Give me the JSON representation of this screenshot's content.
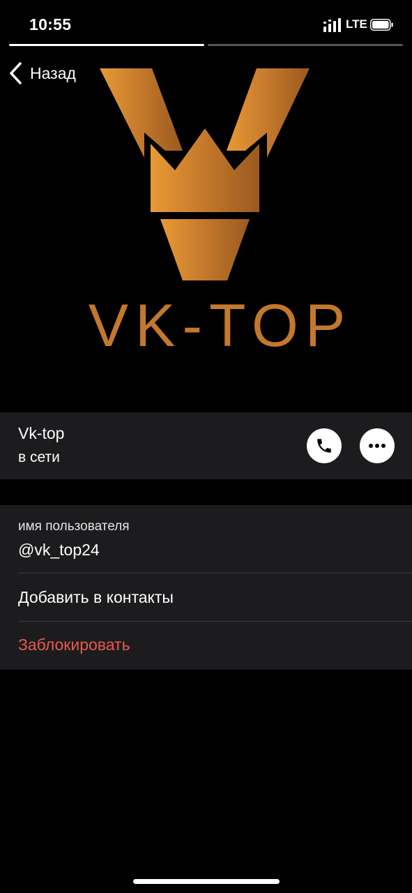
{
  "status_bar": {
    "time": "10:55",
    "network": "LTE",
    "signal_icon": "cellular-signal-icon",
    "battery_icon": "battery-icon"
  },
  "stories": {
    "count": 2,
    "active_index": 0
  },
  "nav": {
    "back_label": "Назад"
  },
  "avatar": {
    "logo_text": "VK-TOP",
    "logo_color": "#c4782b"
  },
  "profile": {
    "name": "Vk-top",
    "status": "в сети"
  },
  "actions": {
    "call_icon": "phone-icon",
    "more_icon": "more-dots-icon"
  },
  "info": {
    "username_label": "имя пользователя",
    "username": "@vk_top24",
    "add_contact": "Добавить в контакты",
    "block": "Заблокировать"
  },
  "colors": {
    "background": "#000000",
    "cell": "#1c1c1e",
    "destructive": "#e8584f",
    "accent_logo": "#c4782b"
  }
}
